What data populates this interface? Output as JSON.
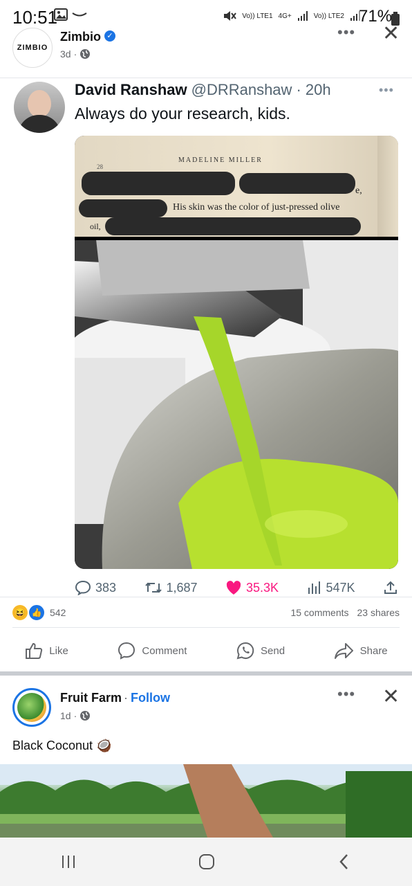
{
  "status_bar": {
    "time": "10:51",
    "battery": "71%",
    "network_labels": [
      "Vo)) LTE1",
      "4G+",
      "Vo)) LTE2"
    ]
  },
  "post1": {
    "avatar_text": "ZIMBIO",
    "page_name": "Zimbio",
    "time": "3d",
    "more_icon": "more-dots-icon",
    "close_icon": "close-icon"
  },
  "tweet": {
    "name": "David Ranshaw",
    "handle": "@DRRanshaw",
    "time": "· 20h",
    "text": "Always do your research, kids.",
    "book": {
      "author": "MADELINE MILLER",
      "page": "28",
      "line_visible": "His skin was the color of just-pressed olive",
      "line_frag_start": "oil,",
      "line_frag_end": "e,"
    },
    "stats": {
      "replies": "383",
      "retweets": "1,687",
      "likes": "35.3K",
      "views": "547K"
    }
  },
  "post1_footer": {
    "reaction_count": "542",
    "comments": "15 comments",
    "shares": "23 shares",
    "actions": [
      "Like",
      "Comment",
      "Send",
      "Share"
    ]
  },
  "post2": {
    "page_name": "Fruit Farm",
    "follow_label": "Follow",
    "time": "1d",
    "caption": "Black Coconut 🥥"
  },
  "colors": {
    "facebook_blue": "#1b74e4",
    "like_pink": "#f91880",
    "olive_oil": "#a6d62a"
  }
}
